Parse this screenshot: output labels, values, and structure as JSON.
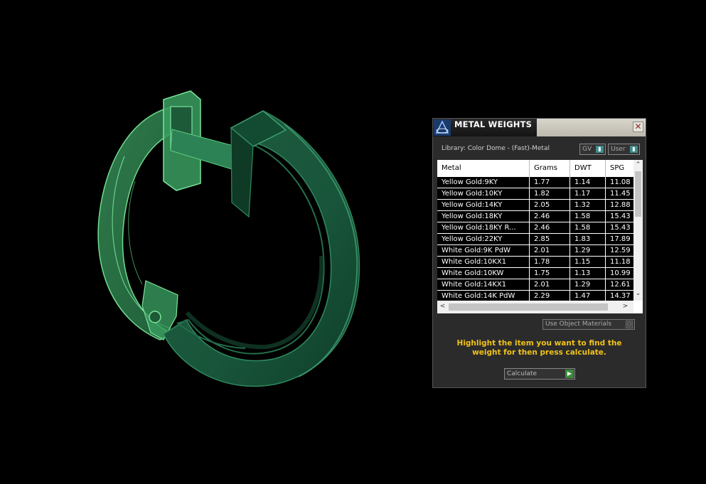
{
  "panel": {
    "title": "METAL WEIGHTS",
    "close_label": "✕",
    "library_label": "Library: Color Dome - (Fast)-Metal",
    "toggles": {
      "gv": "GV",
      "user": "User"
    },
    "table": {
      "headers": [
        "Metal",
        "Grams",
        "DWT",
        "SPG"
      ],
      "rows": [
        [
          "Yellow Gold:9KY",
          "1.77",
          "1.14",
          "11.08"
        ],
        [
          "Yellow Gold:10KY",
          "1.82",
          "1.17",
          "11.45"
        ],
        [
          "Yellow Gold:14KY",
          "2.05",
          "1.32",
          "12.88"
        ],
        [
          "Yellow Gold:18KY",
          "2.46",
          "1.58",
          "15.43"
        ],
        [
          "Yellow Gold:18KY R...",
          "2.46",
          "1.58",
          "15.43"
        ],
        [
          "Yellow Gold:22KY",
          "2.85",
          "1.83",
          "17.89"
        ],
        [
          "White Gold:9K PdW",
          "2.01",
          "1.29",
          "12.59"
        ],
        [
          "White Gold:10KX1",
          "1.78",
          "1.15",
          "11.18"
        ],
        [
          "White Gold:10KW",
          "1.75",
          "1.13",
          "10.99"
        ],
        [
          "White Gold:14KX1",
          "2.01",
          "1.29",
          "12.61"
        ],
        [
          "White Gold:14K PdW",
          "2.29",
          "1.47",
          "14.37"
        ]
      ]
    },
    "use_object_materials": "Use Object Materials",
    "hint": "Highlight the item you want to find the weight for then press calculate.",
    "calculate_label": "Calculate"
  },
  "colors": {
    "accent_yellow": "#f0c21a",
    "toggle_teal": "#3f8c8c",
    "model_green": "#1e6b48"
  }
}
